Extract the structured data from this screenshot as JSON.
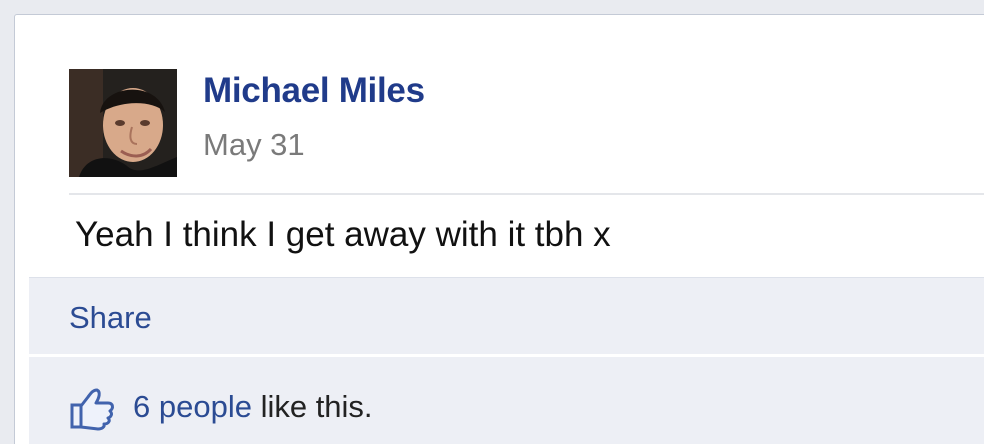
{
  "post": {
    "author": "Michael Miles",
    "timestamp": "May 31",
    "text": "Yeah I think I get away with it tbh x"
  },
  "actions": {
    "share_label": "Share"
  },
  "likes": {
    "count_label": "6 people",
    "suffix": " like this.",
    "icon": "thumbs-up-icon"
  },
  "colors": {
    "author_link": "#203b8a",
    "action_link": "#2b4b93",
    "footer_background": "#edeff5",
    "timestamp": "#7a7a7a"
  }
}
